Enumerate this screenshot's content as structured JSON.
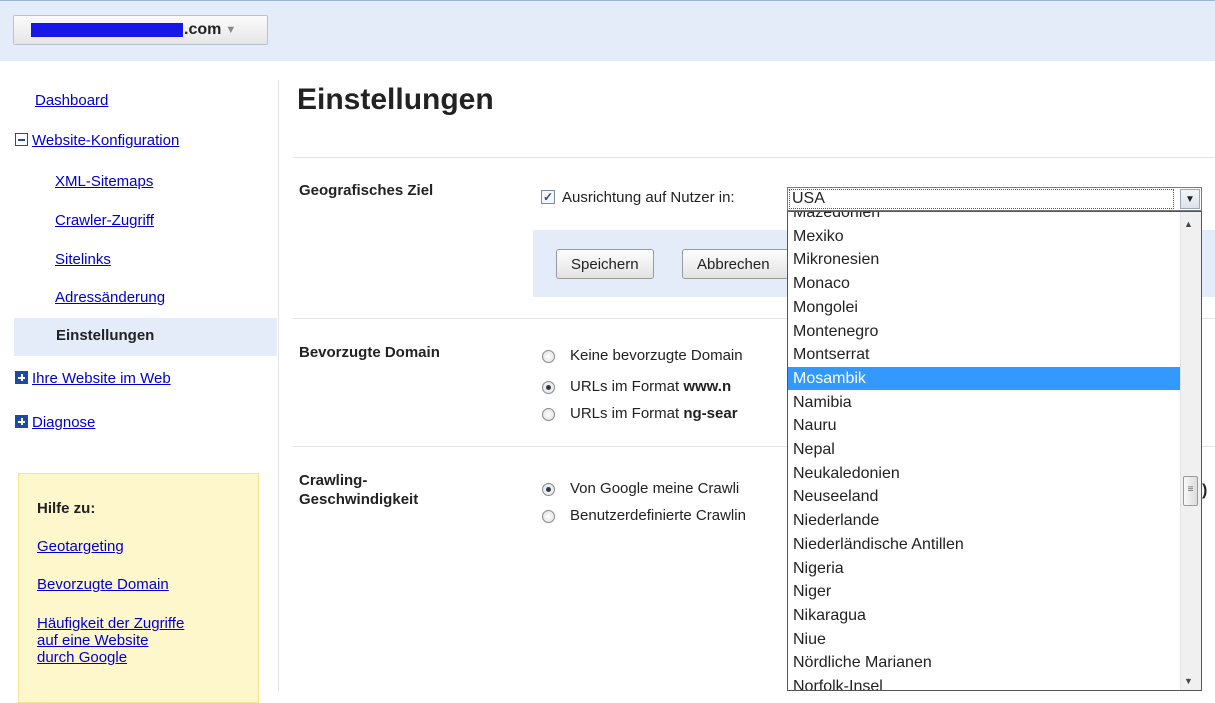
{
  "header": {
    "site_domain_suffix": ".com",
    "dropdown_caret": "▼"
  },
  "sidebar": {
    "dashboard": "Dashboard",
    "website_config": "Website-Konfiguration",
    "sub_items": [
      "XML-Sitemaps",
      "Crawler-Zugriff",
      "Sitelinks",
      "Adressänderung"
    ],
    "active_item": "Einstellungen",
    "web_presence": "Ihre Website im Web",
    "diagnose": "Diagnose"
  },
  "help": {
    "title": "Hilfe zu:",
    "links": [
      "Geotargeting",
      "Bevorzugte Domain",
      "Häufigkeit der Zugriffe",
      "auf eine Website",
      "durch Google"
    ]
  },
  "main": {
    "title": "Einstellungen",
    "geo": {
      "label": "Geografisches Ziel",
      "checkbox_label": "Ausrichtung auf Nutzer in:",
      "selected_country": "USA",
      "save_button": "Speichern",
      "cancel_button": "Abbrechen"
    },
    "domain": {
      "label": "Bevorzugte Domain",
      "opt1": "Keine bevorzugte Domain",
      "opt2_prefix": "URLs im Format ",
      "opt2_bold": "www.n",
      "opt3_prefix": "URLs im Format ",
      "opt3_bold": "ng-sear"
    },
    "crawl": {
      "label_line1": "Crawling-",
      "label_line2": "Geschwindigkeit",
      "opt1": "Von Google meine Crawli",
      "opt2": "Benutzerdefinierte Crawlin",
      "trailing": ")"
    }
  },
  "dropdown": {
    "options": [
      "Mazedonien",
      "Mexiko",
      "Mikronesien",
      "Monaco",
      "Mongolei",
      "Montenegro",
      "Montserrat",
      "Mosambik",
      "Namibia",
      "Nauru",
      "Nepal",
      "Neukaledonien",
      "Neuseeland",
      "Niederlande",
      "Niederländische Antillen",
      "Nigeria",
      "Niger",
      "Nikaragua",
      "Niue",
      "Nördliche Marianen",
      "Norfolk-Insel"
    ],
    "highlighted": "Mosambik",
    "highlight_color": "#3399ff"
  }
}
